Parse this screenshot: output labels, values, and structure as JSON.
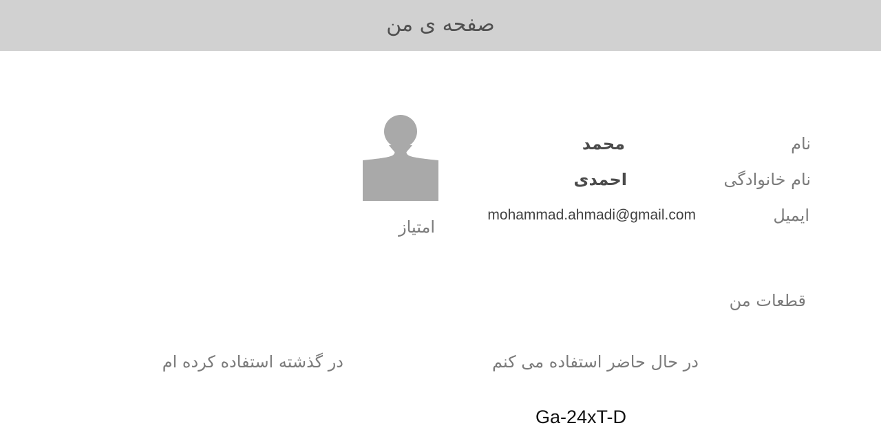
{
  "header": {
    "title": "صفحه ی من"
  },
  "profile": {
    "first_name_label": "نام",
    "first_name_value": "محمد",
    "last_name_label": "نام خانوادگی",
    "last_name_value": "احمدی",
    "email_label": "ایمیل",
    "email_value": "mohammad.ahmadi@gmail.com",
    "avatar_icon": "user-silhouette-icon",
    "score_label": "امتیاز"
  },
  "parts": {
    "section_title": "قطعات من",
    "current_title": "در حال حاضر استفاده می کنم",
    "past_title": "در گذشته استفاده کرده ام",
    "current_items": [
      "Ga-24xT-D"
    ],
    "past_items": []
  },
  "colors": {
    "header_bg": "#d1d1d1",
    "avatar": "#a9a9a9"
  }
}
